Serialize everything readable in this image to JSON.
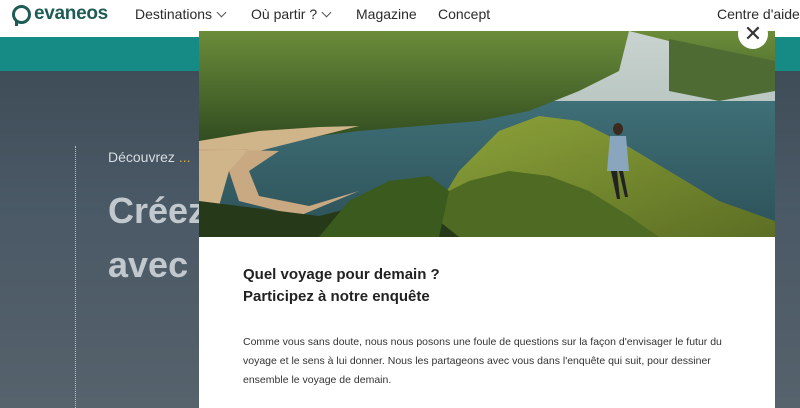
{
  "header": {
    "logo_text": "evaneos",
    "nav": [
      {
        "label": "Destinations"
      },
      {
        "label": "Où partir ?"
      },
      {
        "label": "Magazine"
      },
      {
        "label": "Concept"
      }
    ],
    "help": "Centre d'aide"
  },
  "hero": {
    "eyebrow": "Découvrez",
    "eyebrow_dots": "...",
    "title_line1": "Créez",
    "title_line2": "avec"
  },
  "modal": {
    "close_symbol": "✕",
    "title_line1": "Quel voyage pour demain ?",
    "title_line2": "Participez à notre enquête",
    "body": "Comme vous sans doute, nous nous posons une foule de questions sur la façon d'envisager le futur du voyage et le sens à lui donner. Nous les partageons avec vous dans l'enquête qui suit, pour dessiner ensemble le voyage de demain."
  },
  "colors": {
    "brand": "#1f5c55",
    "teal": "#168a84",
    "accent": "#d6a93c"
  }
}
